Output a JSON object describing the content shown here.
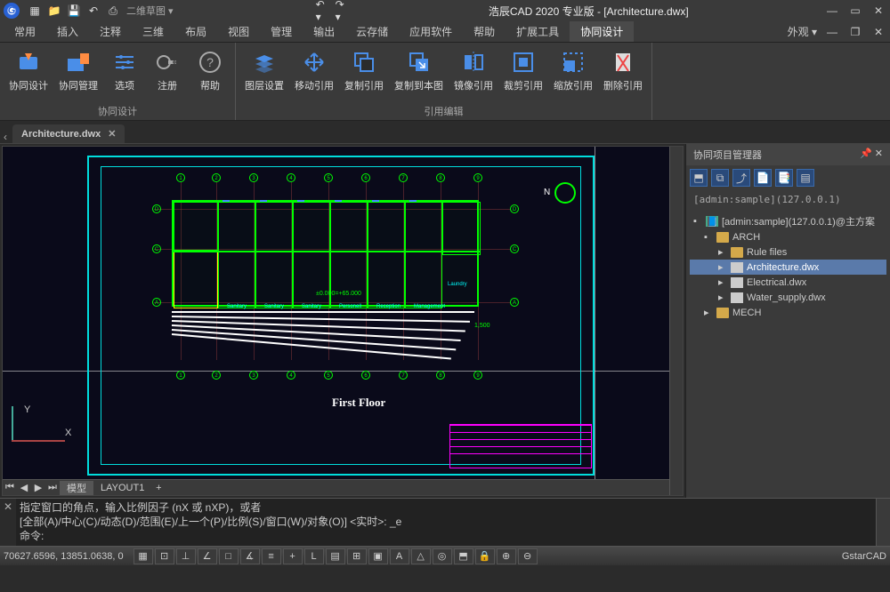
{
  "app": {
    "title": "浩辰CAD 2020 专业版 - [Architecture.dwx]",
    "qat_dropdown": "二维草图",
    "appearance": "外观"
  },
  "menu": {
    "items": [
      "常用",
      "插入",
      "注释",
      "三维",
      "布局",
      "视图",
      "管理",
      "输出",
      "云存储",
      "应用软件",
      "帮助",
      "扩展工具",
      "协同设计"
    ],
    "active_index": 12
  },
  "ribbon": {
    "panel1": {
      "title": "协同设计",
      "buttons": [
        "协同设计",
        "协同管理",
        "选项",
        "注册",
        "帮助"
      ]
    },
    "panel2": {
      "title": "引用编辑",
      "buttons": [
        "图层设置",
        "移动引用",
        "复制引用",
        "复制到本图",
        "镜像引用",
        "裁剪引用",
        "缩放引用",
        "删除引用"
      ]
    }
  },
  "doc_tab": {
    "name": "Architecture.dwx"
  },
  "layout_tabs": {
    "model": "模型",
    "layout1": "LAYOUT1"
  },
  "drawing": {
    "floor_title": "First Floor",
    "room_labels": [
      "Sanitary",
      "Sanitary",
      "Sanitary",
      "Personell",
      "Reception",
      "Management"
    ],
    "elev": "±0.000=+65.000",
    "laundry": "Laundry",
    "dim1": "1,500"
  },
  "ucs": {
    "x": "X",
    "y": "Y"
  },
  "side": {
    "title": "协同项目管理器",
    "connection": "[admin:sample](127.0.0.1)",
    "tree": {
      "root": "[admin:sample](127.0.0.1)@主方案",
      "arch": "ARCH",
      "rules": "Rule files",
      "arch_file": "Architecture.dwx",
      "elec_file": "Electrical.dwx",
      "water_file": "Water_supply.dwx",
      "mech": "MECH"
    }
  },
  "cmd": {
    "line1": "指定窗口的角点，输入比例因子 (nX 或 nXP)，或者",
    "line2": "[全部(A)/中心(C)/动态(D)/范围(E)/上一个(P)/比例(S)/窗口(W)/对象(O)] <实时>: _e",
    "line3": "命令:"
  },
  "status": {
    "coords": "70627.6596, 13851.0638, 0",
    "branding": "GstarCAD"
  }
}
